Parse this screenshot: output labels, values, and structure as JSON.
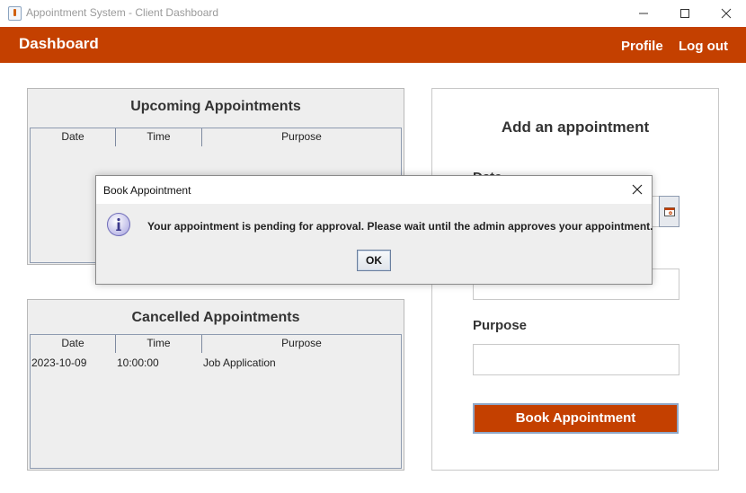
{
  "window": {
    "title": "Appointment System - Client Dashboard"
  },
  "header": {
    "title": "Dashboard",
    "profile_label": "Profile",
    "logout_label": "Log out"
  },
  "upcoming": {
    "title": "Upcoming Appointments",
    "columns": [
      "Date",
      "Time",
      "Purpose"
    ],
    "rows": []
  },
  "cancelled": {
    "title": "Cancelled Appointments",
    "columns": [
      "Date",
      "Time",
      "Purpose"
    ],
    "rows": [
      {
        "date": "2023-10-09",
        "time": "10:00:00",
        "purpose": "Job Application"
      }
    ]
  },
  "form": {
    "title": "Add an appointment",
    "date_label": "Date",
    "purpose_label": "Purpose",
    "book_button": "Book Appointment"
  },
  "dialog": {
    "title": "Book Appointment",
    "message": "Your appointment is pending for approval. Please wait until the admin approves your appointment.",
    "ok_label": "OK"
  },
  "colors": {
    "accent": "#c44000",
    "panel_bg": "#eeeeee"
  },
  "icons": {
    "info": "info-icon",
    "calendar": "calendar-icon",
    "close": "close-icon"
  }
}
